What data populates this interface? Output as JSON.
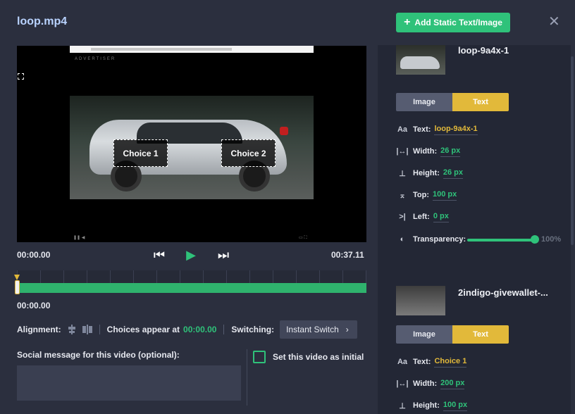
{
  "header": {
    "title": "loop.mp4",
    "add_button": "Add Static Text/Image",
    "close_icon": "close-icon"
  },
  "video": {
    "brand": "ADVERTISER",
    "choices": [
      "Choice 1",
      "Choice 2"
    ]
  },
  "player": {
    "current_time": "00:00.00",
    "total_time": "00:37.11",
    "timeline_time": "00:00.00"
  },
  "options": {
    "alignment_label": "Alignment:",
    "choices_appear_label": "Choices appear at",
    "choices_appear_value": "00:00.00",
    "switching_label": "Switching:",
    "switching_value": "Instant Switch"
  },
  "social": {
    "label": "Social message for this video (optional):",
    "initial_checkbox_label": "Set this video as initial"
  },
  "panel": {
    "cards": [
      {
        "title": "loop-9a4x-1",
        "toggle_image": "Image",
        "toggle_text": "Text",
        "text_label": "Text:",
        "text_value": "loop-9a4x-1",
        "width_label": "Width:",
        "width_value": "26 px",
        "height_label": "Height:",
        "height_value": "26 px",
        "top_label": "Top:",
        "top_value": "100 px",
        "left_label": "Left:",
        "left_value": "0 px",
        "transparency_label": "Transparency:",
        "transparency_value": "100%"
      },
      {
        "title": "2indigo-givewallet-...",
        "toggle_image": "Image",
        "toggle_text": "Text",
        "text_label": "Text:",
        "text_value": "Choice 1",
        "width_label": "Width:",
        "width_value": "200 px",
        "height_label": "Height:",
        "height_value": "100 px"
      }
    ]
  },
  "colors": {
    "accent_green": "#2fc27a",
    "accent_yellow": "#e2b93a",
    "background": "#2b2f3e",
    "panel": "#232735"
  }
}
